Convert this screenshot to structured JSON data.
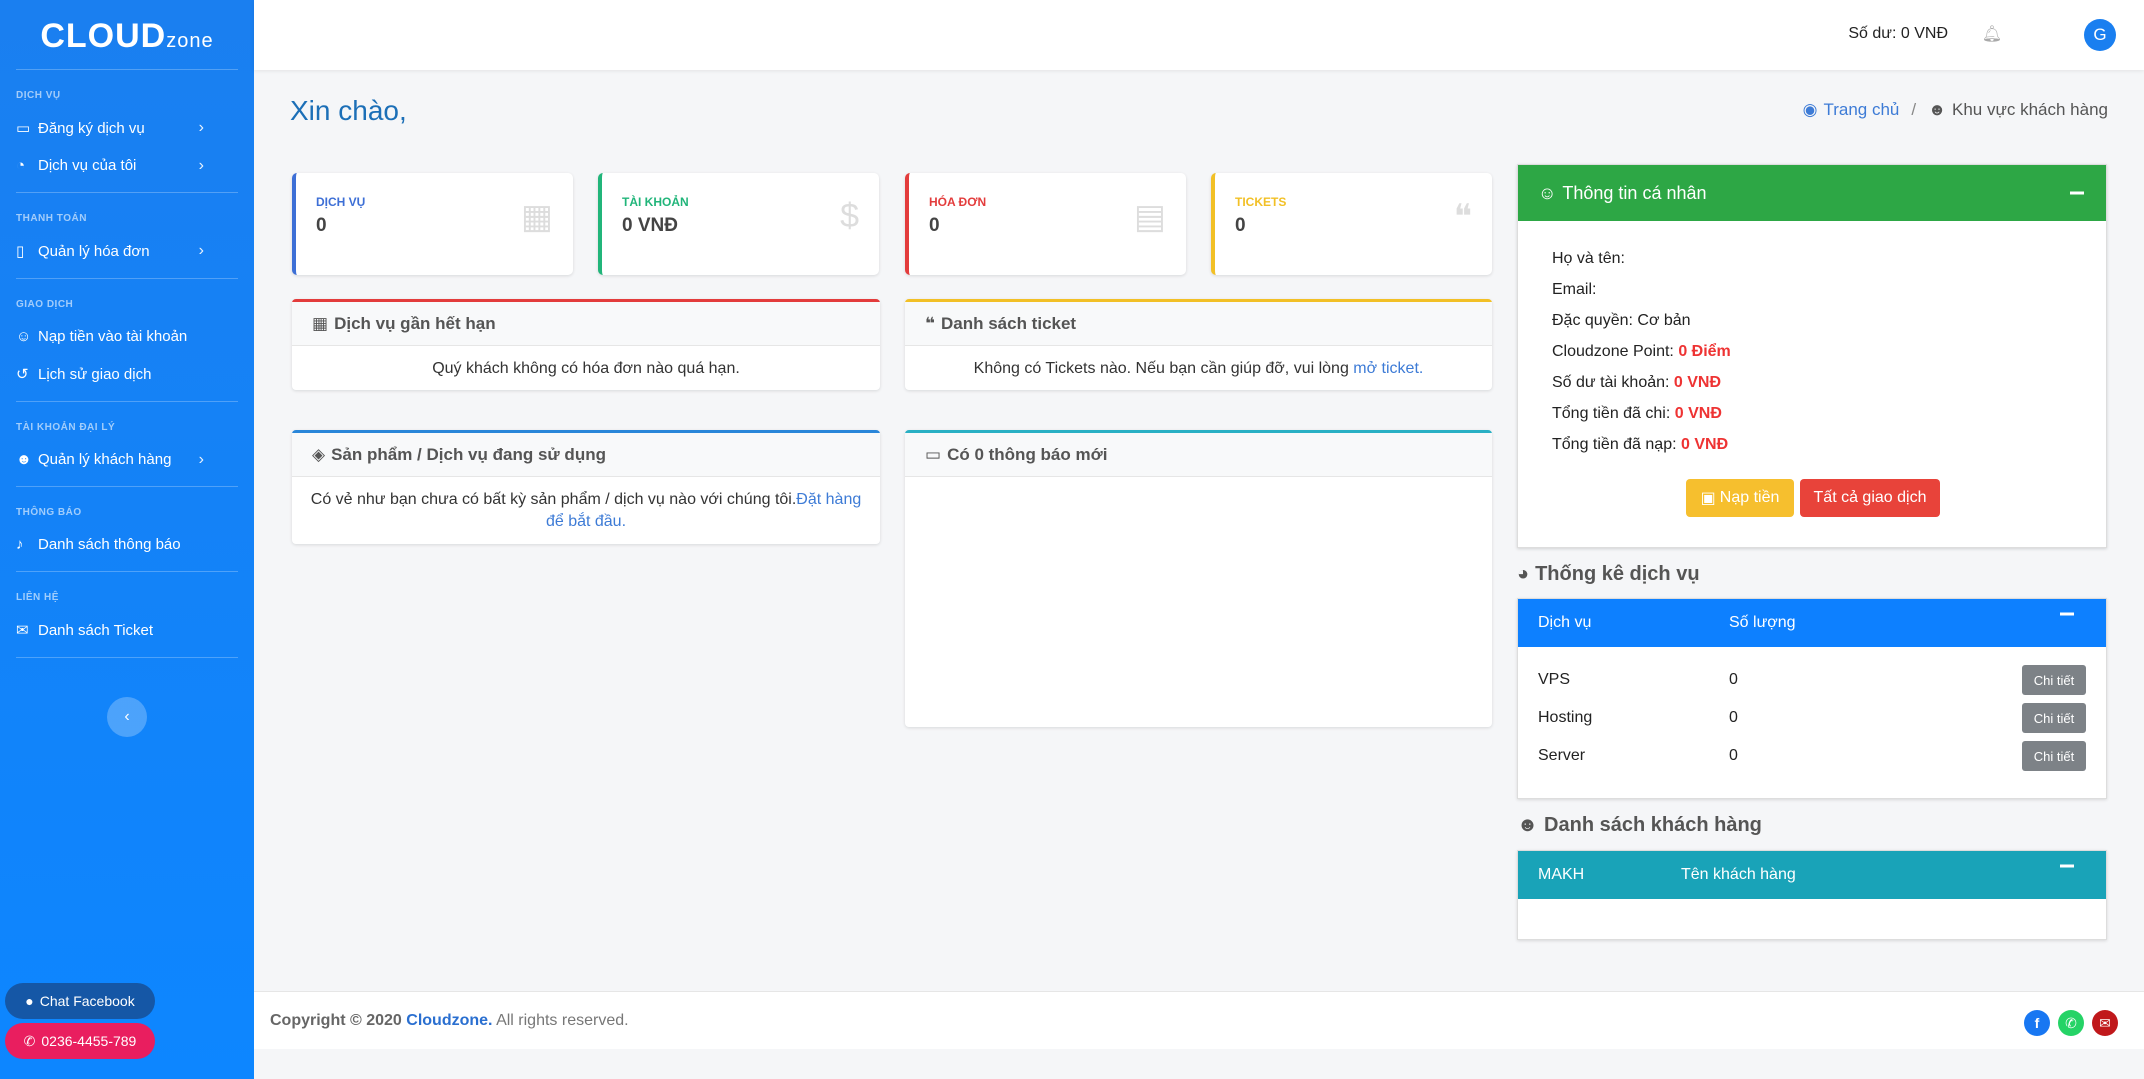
{
  "brand": {
    "logo_main": "CLOUD",
    "logo_sub": "zone"
  },
  "sidebar": {
    "sections": [
      {
        "title": "DỊCH VỤ",
        "items": [
          {
            "label": "Đăng ký dịch vụ",
            "icon": "store-icon",
            "chevron": true
          },
          {
            "label": "Dịch vụ của tôi",
            "icon": "pie-chart-icon",
            "chevron": true
          }
        ]
      },
      {
        "title": "THANH TOÁN",
        "items": [
          {
            "label": "Quản lý hóa đơn",
            "icon": "file-icon",
            "chevron": true
          }
        ]
      },
      {
        "title": "GIAO DỊCH",
        "items": [
          {
            "label": "Nạp tiền vào tài khoản",
            "icon": "user-icon",
            "chevron": false
          },
          {
            "label": "Lịch sử giao dịch",
            "icon": "history-icon",
            "chevron": false
          }
        ]
      },
      {
        "title": "TÀI KHOẢN ĐẠI LÝ",
        "items": [
          {
            "label": "Quản lý khách hàng",
            "icon": "users-icon",
            "chevron": true
          }
        ]
      },
      {
        "title": "THÔNG BÁO",
        "items": [
          {
            "label": "Danh sách thông báo",
            "icon": "bell-icon",
            "chevron": false
          }
        ]
      },
      {
        "title": "LIÊN HỆ",
        "items": [
          {
            "label": "Danh sách Ticket",
            "icon": "comments-icon",
            "chevron": false
          }
        ]
      }
    ],
    "chat_facebook": "Chat Facebook",
    "phone": "0236-4455-789"
  },
  "topbar": {
    "balance": "Số dư: 0 VNĐ",
    "avatar_letter": "G"
  },
  "header": {
    "greeting": "Xin chào,",
    "breadcrumb_home": "Trang chủ",
    "breadcrumb_current": "Khu vực khách hàng"
  },
  "stats": [
    {
      "label": "DỊCH VỤ",
      "value": "0",
      "color": "#3d6fd6"
    },
    {
      "label": "TÀI KHOẢN",
      "value": "0 VNĐ",
      "color": "#21b57a"
    },
    {
      "label": "HÓA ĐƠN",
      "value": "0",
      "color": "#e33c3c"
    },
    {
      "label": "TICKETS",
      "value": "0",
      "color": "#f2c026"
    }
  ],
  "panels": {
    "expiring": {
      "title": "Dịch vụ gần hết hạn",
      "body": "Quý khách không có hóa đơn nào quá hạn."
    },
    "tickets": {
      "title": "Danh sách ticket",
      "body": "Không có Tickets nào. Nếu bạn cần giúp đỡ, vui lòng ",
      "link": "mở ticket."
    },
    "products": {
      "title": "Sản phẩm / Dịch vụ đang sử dụng",
      "body": "Có vẻ như bạn chưa có bất kỳ sản phẩm / dịch vụ nào với chúng tôi.",
      "link": "Đặt hàng để bắt đầu."
    },
    "notices": {
      "title": "Có 0 thông báo mới"
    }
  },
  "personal": {
    "title": "Thông tin cá nhân",
    "name_label": "Họ và tên:",
    "email_label": "Email:",
    "privilege_label": "Đặc quyền:",
    "privilege_value": "Cơ bản",
    "point_label": "Cloudzone Point:",
    "point_value": "0 Điểm",
    "balance_label": "Số dư tài khoản:",
    "balance_value": "0 VNĐ",
    "spent_label": "Tổng tiền đã chi:",
    "spent_value": "0 VNĐ",
    "deposit_label": "Tổng tiền đã nạp:",
    "deposit_value": "0 VNĐ",
    "btn_deposit": "Nạp tiền",
    "btn_all": "Tất cả giao dịch"
  },
  "service_stats": {
    "title": "Thống kê dịch vụ",
    "col_service": "Dịch vụ",
    "col_qty": "Số lượng",
    "rows": [
      {
        "name": "VPS",
        "qty": "0",
        "btn": "Chi tiết"
      },
      {
        "name": "Hosting",
        "qty": "0",
        "btn": "Chi tiết"
      },
      {
        "name": "Server",
        "qty": "0",
        "btn": "Chi tiết"
      }
    ]
  },
  "customers": {
    "title": "Danh sách khách hàng",
    "col_code": "MAKH",
    "col_name": "Tên khách hàng"
  },
  "footer": {
    "copyright": "Copyright © 2020",
    "brand": "Cloudzone.",
    "rights": "All rights reserved."
  }
}
